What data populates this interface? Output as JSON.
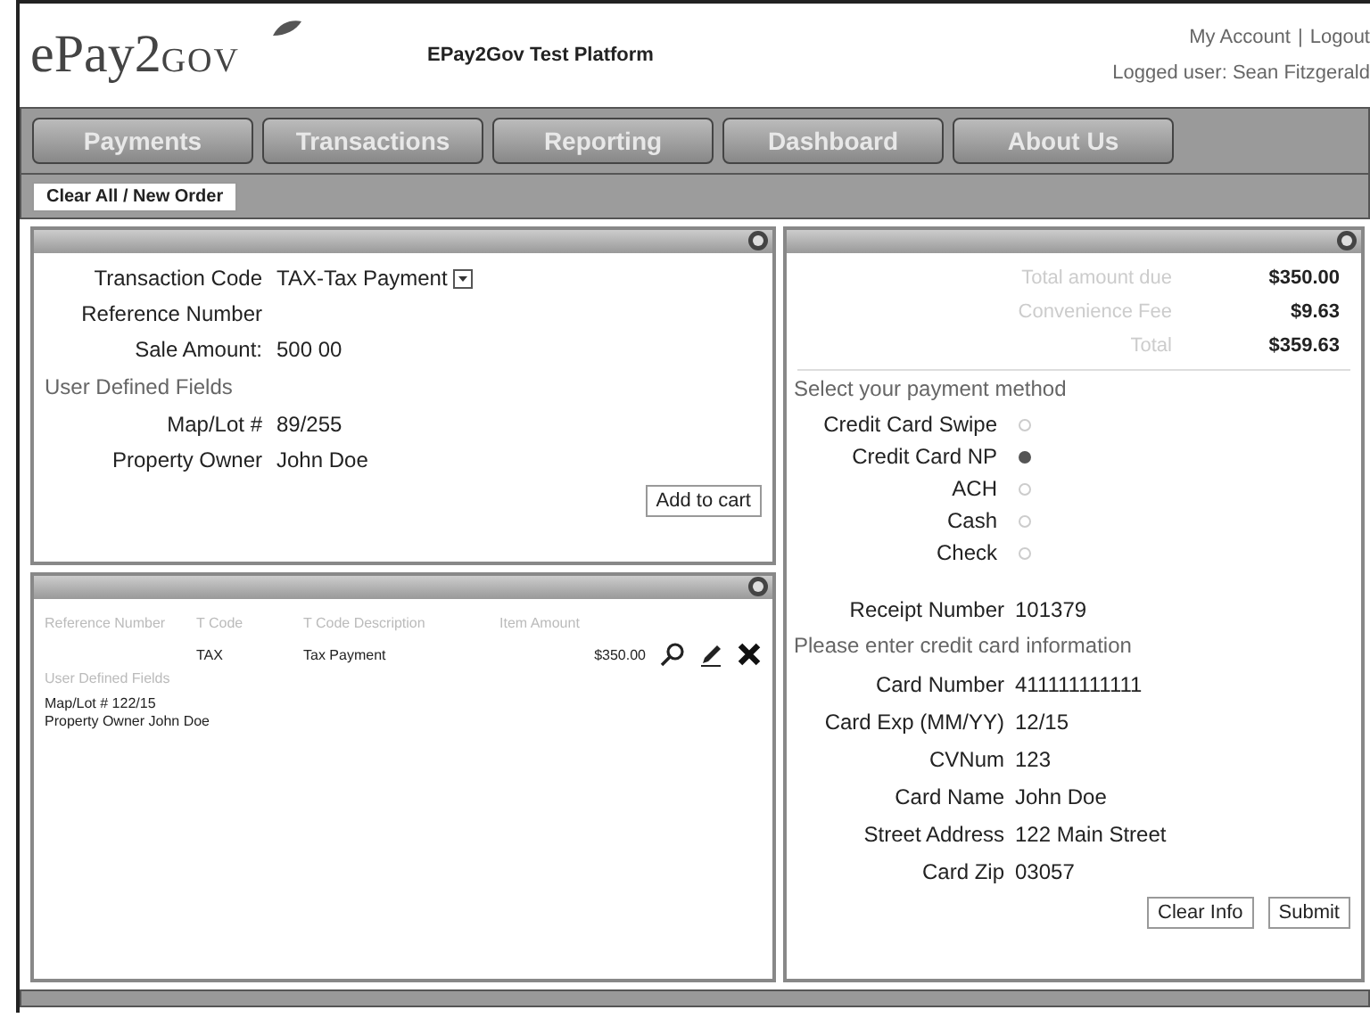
{
  "header": {
    "logo": "ePay2",
    "logo_suffix": "GOV",
    "title": "EPay2Gov Test Platform",
    "account_link": "My Account",
    "separator": "|",
    "logout_link": "Logout",
    "logged_user": "Logged user: Sean Fitzgerald"
  },
  "nav_tabs": [
    {
      "label": "Payments"
    },
    {
      "label": "Transactions"
    },
    {
      "label": "Reporting"
    },
    {
      "label": "Dashboard"
    },
    {
      "label": "About Us"
    }
  ],
  "toolbar": {
    "button": "Clear All / New Order"
  },
  "transaction_panel": {
    "fields": [
      {
        "kind": "select",
        "label": "Transaction Code",
        "value": "TAX-Tax Payment"
      },
      {
        "kind": "text",
        "label": "Reference Number"
      },
      {
        "kind": "text",
        "label": "Sale Amount:",
        "value": "500 00"
      },
      {
        "kind": "heading",
        "label": "User Defined Fields"
      },
      {
        "kind": "text",
        "label": "Map/Lot #",
        "value": "89/255"
      },
      {
        "kind": "text",
        "label": "Property Owner",
        "value": "John Doe"
      }
    ],
    "button": "Add to cart"
  },
  "cart_panel": {
    "columns": [
      "Reference Number",
      "T Code",
      "T Code Description",
      "Item Amount"
    ],
    "rows": [
      {
        "code": "TAX",
        "description": "Tax Payment",
        "amount": "$350.00",
        "udf_heading": "User Defined Fields",
        "details": [
          "Map/Lot #   122/15",
          "Property Owner   John Doe"
        ]
      }
    ]
  },
  "payment_panel": {
    "summary": [
      {
        "label": "Total amount due",
        "value": "$350.00"
      },
      {
        "label": "Convenience Fee",
        "value": "$9.63"
      },
      {
        "label": "Total",
        "value": "$359.63"
      }
    ],
    "method_prompt": "Select your payment method",
    "methods": [
      {
        "label": "Credit Card Swipe",
        "selected": false
      },
      {
        "label": "Credit Card NP",
        "selected": true
      },
      {
        "label": "ACH",
        "selected": false
      },
      {
        "label": "Cash",
        "selected": false
      },
      {
        "label": "Check",
        "selected": false
      }
    ],
    "receipt": {
      "label": "Receipt Number",
      "value": "101379"
    },
    "card_prompt": "Please enter credit card information",
    "card_fields": [
      {
        "label": "Card Number",
        "value": "411111111111"
      },
      {
        "label": "Card Exp (MM/YY)",
        "value": "12/15"
      },
      {
        "label": "CVNum",
        "value": "123"
      },
      {
        "label": "Card Name",
        "value": "John Doe"
      },
      {
        "label": "Street Address",
        "value": "122 Main Street"
      },
      {
        "label": "Card Zip",
        "value": "03057"
      }
    ],
    "buttons": [
      "Clear Info",
      "Submit"
    ]
  }
}
